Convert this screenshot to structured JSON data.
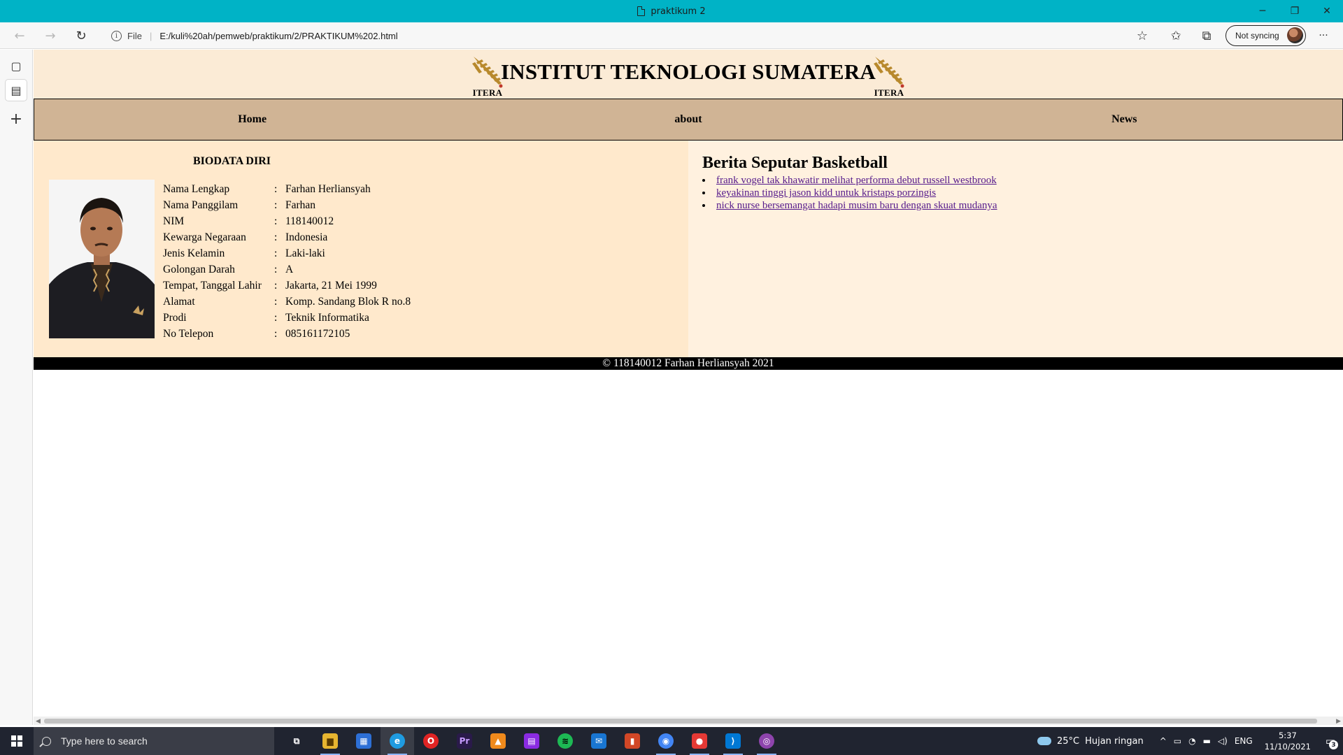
{
  "window": {
    "title": "praktikum 2",
    "minimize_glyph": "─",
    "maximize_glyph": "❐",
    "close_glyph": "✕"
  },
  "toolbar": {
    "back_icon": "←",
    "forward_icon": "→",
    "refresh_icon": "↻",
    "info_icon": "i",
    "scheme": "File",
    "url": "E:/kuli%20ah/pemweb/praktikum/2/PRAKTIKUM%202.html",
    "sync_label": "Not syncing",
    "more_icon": "···",
    "favorite_add_icon": "☆",
    "favorites_icon": "✩",
    "collections_icon": "⧉"
  },
  "sidestrip": {
    "tab_actions_icon": "▢",
    "page_icon": "▤",
    "new_tab_icon": "+"
  },
  "page": {
    "header": {
      "title": "INSTITUT TEKNOLOGI SUMATERA",
      "logo_text": "ITERA"
    },
    "nav": [
      {
        "label": "Home"
      },
      {
        "label": "about"
      },
      {
        "label": "News"
      }
    ],
    "biodata": {
      "title": "BIODATA DIRI",
      "rows": [
        {
          "label": "Nama Lengkap",
          "colon": ":",
          "value": "Farhan Herliansyah"
        },
        {
          "label": "Nama Panggilam",
          "colon": ":",
          "value": "Farhan"
        },
        {
          "label": "NIM",
          "colon": ":",
          "value": "118140012"
        },
        {
          "label": "Kewarga Negaraan",
          "colon": ":",
          "value": "Indonesia"
        },
        {
          "label": "Jenis Kelamin",
          "colon": ":",
          "value": "Laki-laki"
        },
        {
          "label": "Golongan Darah",
          "colon": ":",
          "value": "A"
        },
        {
          "label": "Tempat, Tanggal Lahir",
          "colon": ":",
          "value": "Jakarta, 21 Mei 1999"
        },
        {
          "label": "Alamat",
          "colon": ":",
          "value": "Komp. Sandang Blok R no.8"
        },
        {
          "label": "Prodi",
          "colon": ":",
          "value": "Teknik Informatika"
        },
        {
          "label": "No Telepon",
          "colon": ":",
          "value": "085161172105"
        }
      ]
    },
    "news": {
      "title": "Berita Seputar Basketball",
      "items": [
        {
          "label": "frank vogel tak khawatir melihat performa debut russell westbrook"
        },
        {
          "label": "keyakinan tinggi jason kidd untuk kristaps porzingis"
        },
        {
          "label": "nick nurse bersemangat hadapi musim baru dengan skuat mudanya"
        }
      ]
    },
    "footer": "© 118140012 Farhan Herliansyah 2021",
    "colors": {
      "header_bg": "#fbebd6",
      "nav_bg": "#d0b495",
      "left_panel_bg": "#ffe9cc",
      "right_panel_bg": "#fff1df",
      "link_visited": "#551a8b",
      "footer_bg": "#000000"
    }
  },
  "taskbar": {
    "search_placeholder": "Type here to search",
    "apps": [
      {
        "name": "task-view",
        "glyph": "⧉"
      },
      {
        "name": "file-explorer",
        "glyph": "▆"
      },
      {
        "name": "microsoft-store",
        "glyph": "▦"
      },
      {
        "name": "edge",
        "glyph": "e"
      },
      {
        "name": "opera",
        "glyph": "O"
      },
      {
        "name": "premiere-pro",
        "glyph": "Pr"
      },
      {
        "name": "vlc",
        "glyph": "▲"
      },
      {
        "name": "winrar",
        "glyph": "▤"
      },
      {
        "name": "spotify",
        "glyph": "≋"
      },
      {
        "name": "mail",
        "glyph": "✉"
      },
      {
        "name": "office",
        "glyph": "▮"
      },
      {
        "name": "chrome",
        "glyph": "◉"
      },
      {
        "name": "app-red",
        "glyph": "●"
      },
      {
        "name": "vscode",
        "glyph": "⟩"
      },
      {
        "name": "github-desktop",
        "glyph": "◎"
      }
    ],
    "weather_temp": "25°C",
    "weather_desc": "Hujan ringan",
    "tray_chevron": "^",
    "lang": "ENG",
    "time": "5:37",
    "date": "11/10/2021",
    "notification_count": "3"
  }
}
